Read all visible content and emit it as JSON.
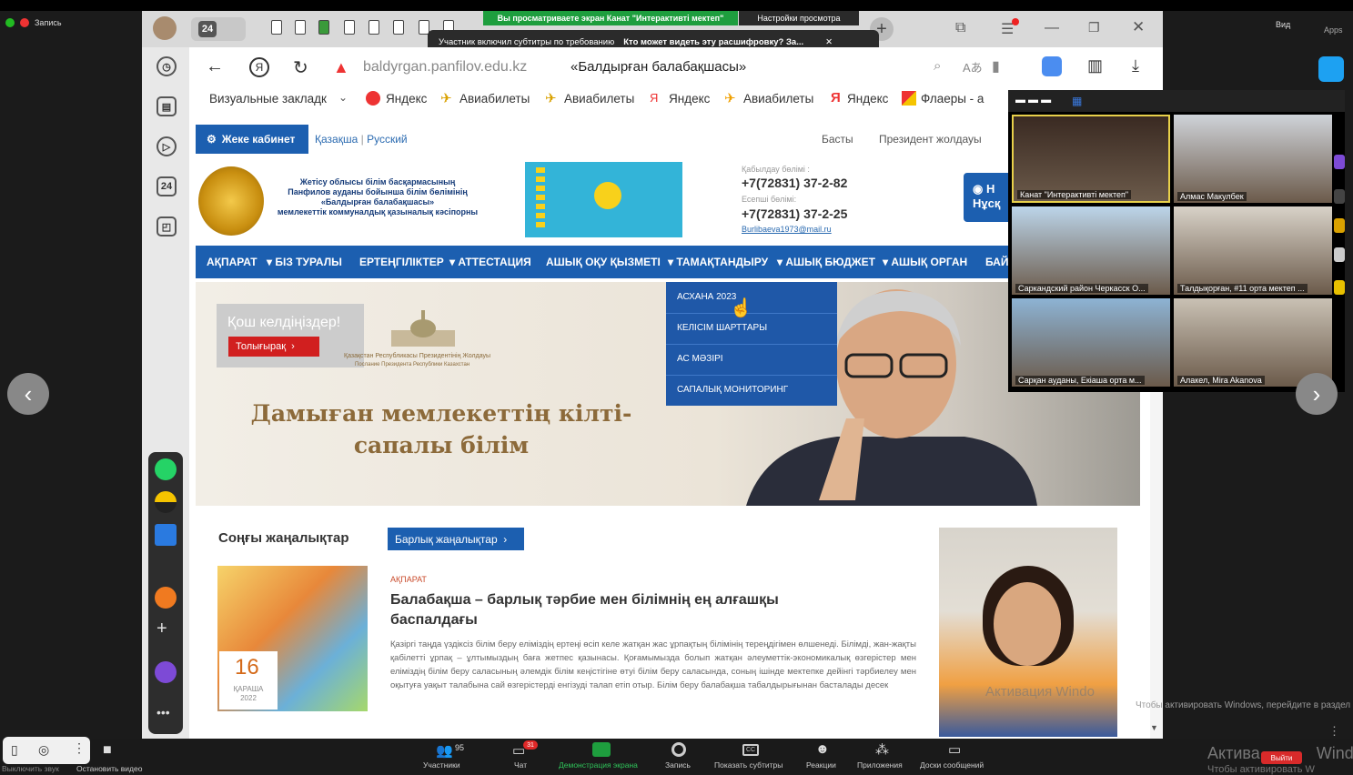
{
  "zoom": {
    "record_label": "Запись",
    "view_label": "Вид",
    "apps_label": "Apps",
    "sharing_banner": "Вы просматриваете экран Канат \"Интерактивті мектеп\"",
    "view_settings": "Настройки просмотра",
    "caption_notice": "Участник включил субтитры по требованию",
    "caption_question": "Кто может видеть эту расшифровку? За...",
    "tab_count": "24"
  },
  "browser": {
    "url": "baldyrgan.panfilov.edu.kz",
    "page_title": "«Балдырған балабақшасы»",
    "bookmarks": [
      "Визуальные закладк",
      "Яндекс",
      "Авиабилеты",
      "Авиабилеты",
      "Яндекс",
      "Авиабилеты",
      "Яндекс",
      "Флаеры - а"
    ]
  },
  "site": {
    "kabinet": "Жеке кабинет",
    "lang_kz": "Қазақша",
    "lang_sep": "|",
    "lang_ru": "Русский",
    "basty": "Басты",
    "president": "Президент жолдауы",
    "org_line1": "Жетісу облысы білім басқармасының",
    "org_line2": "Панфилов ауданы бойынша білім бөлімінің",
    "org_line3": "«Балдырған балабақшасы»",
    "org_line4": "мемлекеттік коммуналдық қазыналық кәсіпорны",
    "reception_label": "Қабылдау бөлімі :",
    "phone1": "+7(72831) 37-2-82",
    "accounting_label": "Есепші бөлімі:",
    "phone2": "+7(72831) 37-2-25",
    "email": "Burlibaeva1973@mail.ru",
    "blue_button": "Нұсқ",
    "blue_button_top": "Н",
    "nav": [
      "АҚПАРАТ",
      "▾ БІЗ ТУРАЛЫ",
      "ЕРТЕҢГІЛІКТЕР",
      "▾ АТТЕСТАЦИЯ",
      "АШЫҚ ОҚУ ҚЫЗМЕТІ",
      "▾ ТАМАҚТАНДЫРУ",
      "▾ АШЫҚ БЮДЖЕТ",
      "▾ АШЫҚ ОРГАН",
      "БАЙ"
    ],
    "dropdown": [
      "АСХАНА 2023",
      "КЕЛІСІМ ШАРТТАРЫ",
      "АС МӘЗІРІ",
      "САПАЛЫҚ МОНИТОРИНГ"
    ],
    "welcome": "Қош келдіңіздер!",
    "more": "Толығырақ",
    "akorda_caption": "Қазақстан Республикасы Президентінің Жолдауы",
    "akorda_caption2": "Послание Президента Республики Казахстан",
    "motto_line1": "Дамыған мемлекеттің кілті-",
    "motto_line2": "сапалы білім",
    "news_heading": "Соңғы жаңалықтар",
    "all_news": "Барлық жаңалықтар",
    "date_day": "16",
    "date_month": "ҚАРАША",
    "date_year": "2022",
    "category": "АҚПАРАТ",
    "news_title": "Балабақша – барлық тәрбие мен білімнің ең алғашқы баспалдағы",
    "news_body": "Қазіргі таңда үздіксіз білім беру еліміздің ертеңі өсіп келе жатқан жас ұрпақтың білімінің тереңдігімен өлшенеді. Білімді, жан-жақты қабілетті ұрпақ – ұлтымыздың баға жетпес қазынасы. Қоғамымызда болып жатқан әлеуметтік-экономикалық өзгерістер мен еліміздің білім беру саласының әлемдік білім кеңістігіне өтуі білім беру саласында, соның ішінде мектепке дейінгі тәрбиелеу мен оқытуға уақыт талабына сай өзгерістерді енгізуді талап етіп отыр. Білім беру балабақша табалдырығынан басталады десек"
  },
  "gallery": [
    {
      "name": "Канат \"Интерактивті мектеп\"",
      "bg": "#3a2a22"
    },
    {
      "name": "Алмас Макулбек",
      "bg": "#cfd3d9"
    },
    {
      "name": "Саркандский район Черкасск О...",
      "bg": "#bcd5ea"
    },
    {
      "name": "Талдықорған, #11 орта мектеп ...",
      "bg": "#d8d2c8"
    },
    {
      "name": "Сарқан ауданы, Екіаша орта м...",
      "bg": "#8db3d4"
    },
    {
      "name": "Алакел, Mira Akanova",
      "bg": "#c9c1b4"
    }
  ],
  "toolbar": {
    "mute": "Выключить звук",
    "video": "Остановить видео",
    "participants": "Участники",
    "participants_count": "95",
    "chat": "Чат",
    "chat_badge": "31",
    "share": "Демонстрация экрана",
    "record": "Запись",
    "captions": "Показать субтитры",
    "reactions": "Реакции",
    "apps": "Приложения",
    "whiteboards": "Доски сообщений",
    "exit": "Выйти"
  },
  "windows_watermark": {
    "line1": "Актива",
    "line1b": "Windo",
    "line2": "Чтобы активировать W",
    "overlay": "Чтобы активировать Windows, перейдите в раздел \"Параметры\".",
    "center": "Активация Windo"
  },
  "colors": {
    "accent": "#1c5fb0",
    "zoom_green": "#1e9e3e",
    "alert_red": "#d11f1f"
  }
}
